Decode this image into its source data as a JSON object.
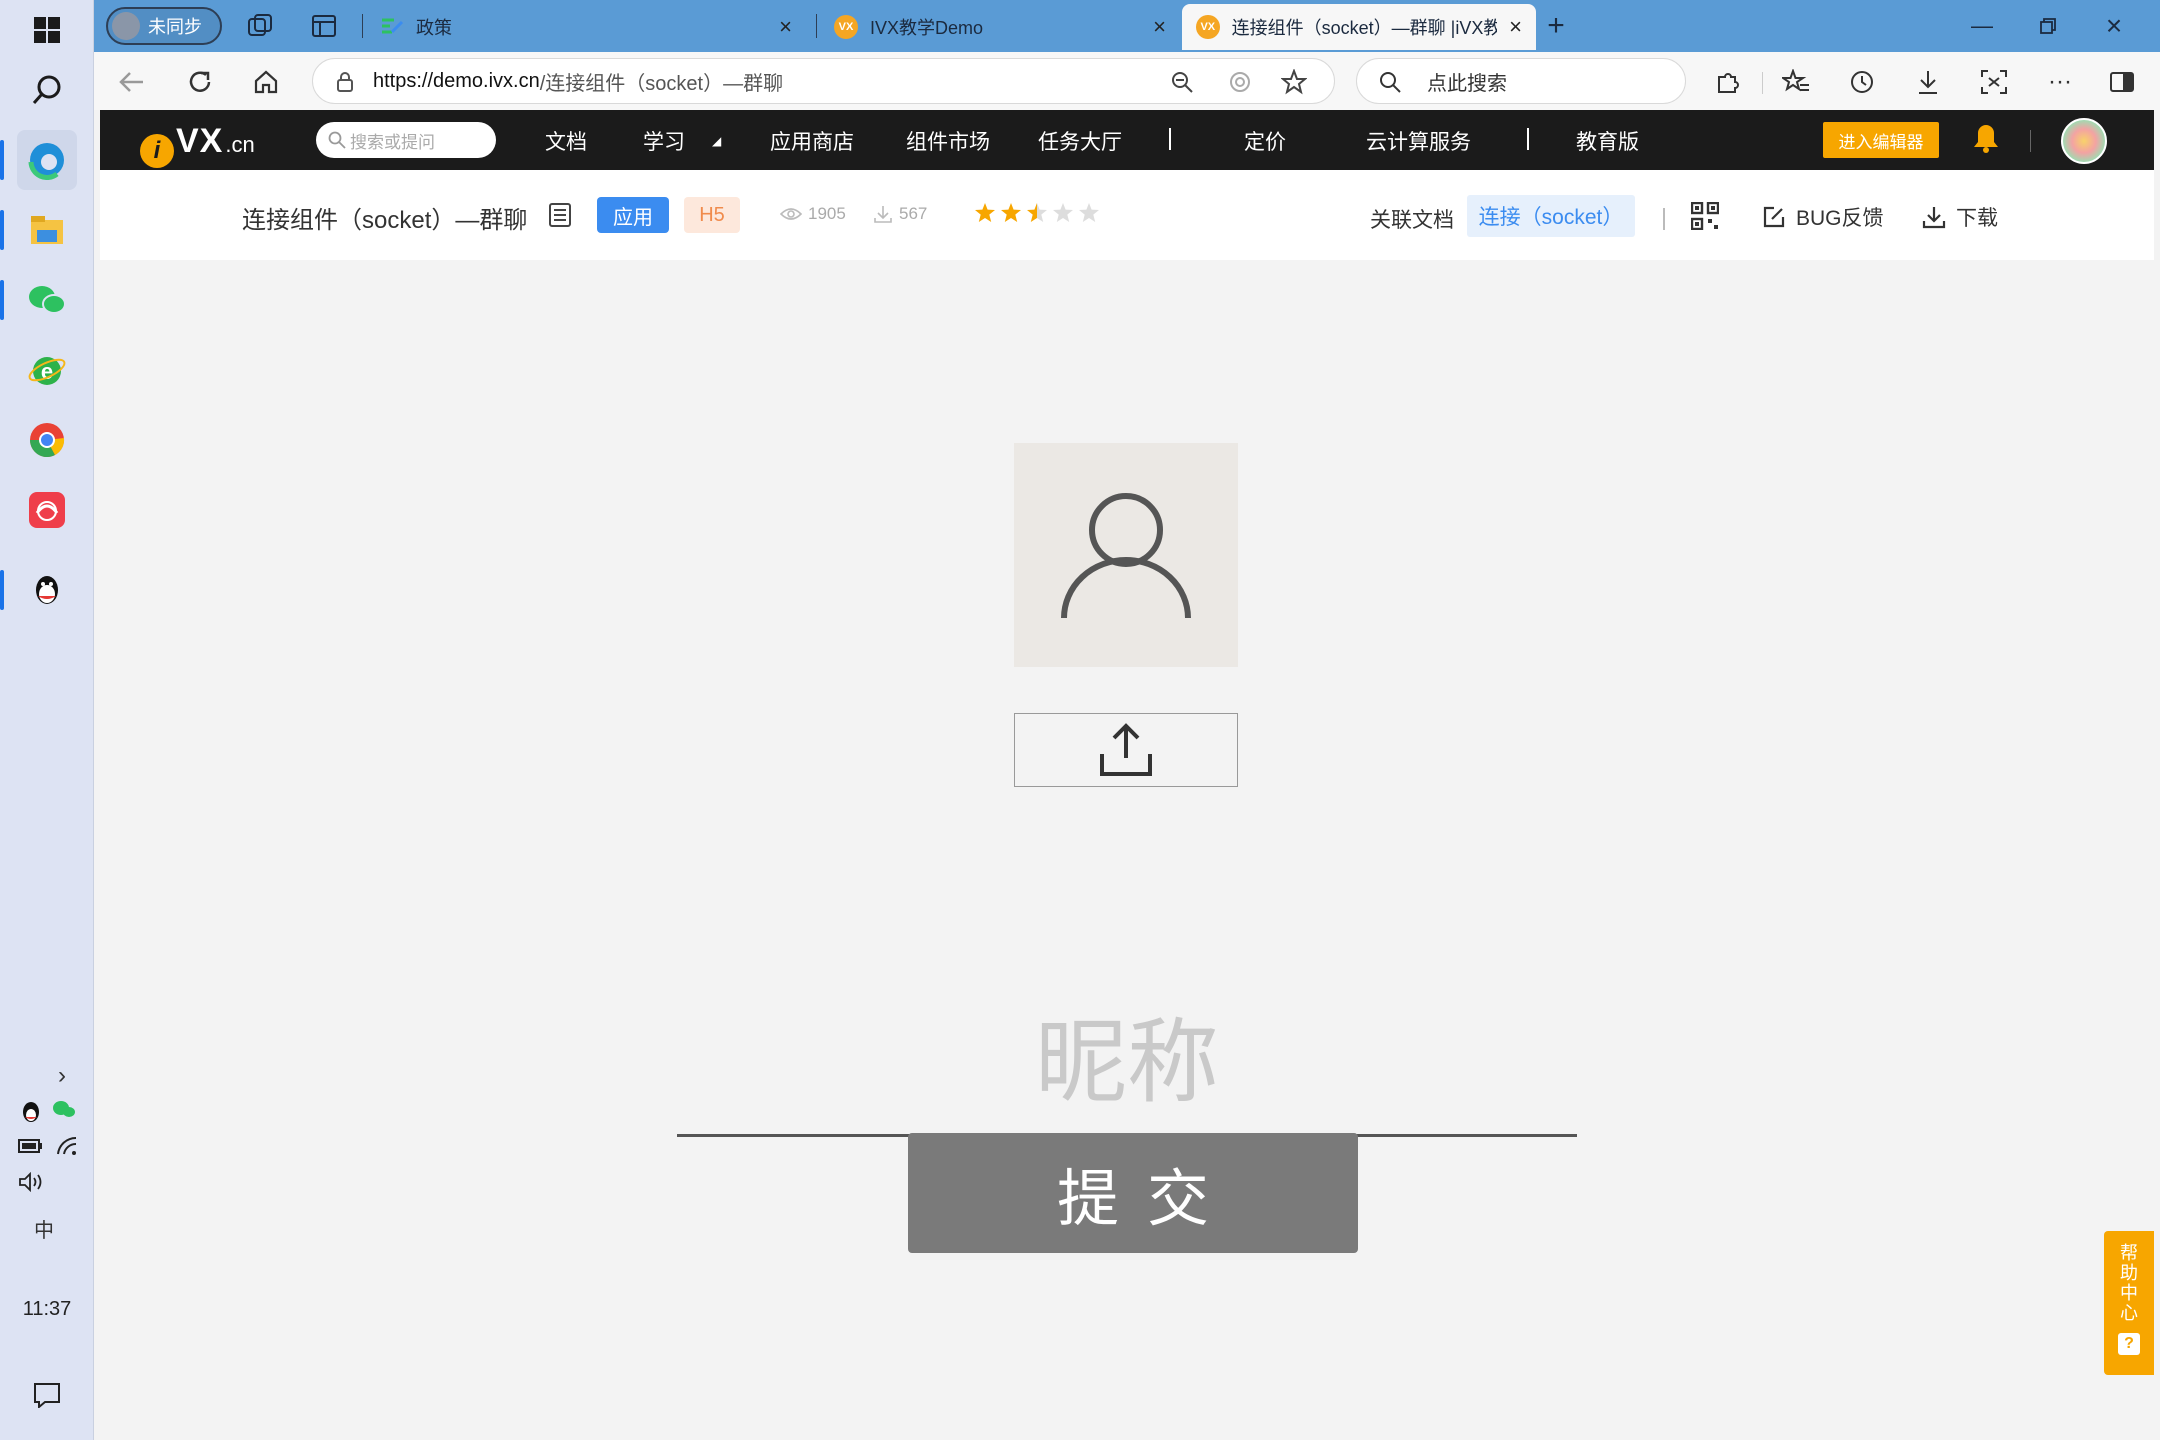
{
  "taskbar": {
    "time": "11:37",
    "ime": "中"
  },
  "browser": {
    "profile_label": "未同步",
    "tabs": [
      {
        "label": "政策"
      },
      {
        "label": "IVX教学Demo",
        "favicon": "VX"
      },
      {
        "label": "连接组件（socket）—群聊 |iVX教",
        "favicon": "VX"
      }
    ],
    "url_host": "https://demo.ivx.cn",
    "url_rest": "/连接组件（socket）—群聊",
    "search_placeholder": "点此搜索"
  },
  "site": {
    "logo_vx": "VX",
    "logo_cn": ".cn",
    "logo_i": "i",
    "search_placeholder": "搜索或提问",
    "nav": {
      "docs": "文档",
      "learn": "学习",
      "app_store": "应用商店",
      "component_market": "组件市场",
      "task_hall": "任务大厅",
      "pricing": "定价",
      "cloud": "云计算服务",
      "edu": "教育版"
    },
    "enter_editor": "进入编辑器"
  },
  "subheader": {
    "title": "连接组件（socket）—群聊",
    "badge_app": "应用",
    "badge_h5": "H5",
    "views": "1905",
    "downloads": "567",
    "rating": 2.5,
    "rating_max": 5,
    "related_docs_label": "关联文档",
    "related_doc_chip": "连接（socket）",
    "bug_feedback": "BUG反馈",
    "download": "下载"
  },
  "app": {
    "nickname_placeholder": "昵称",
    "submit_label": "提交"
  },
  "help": {
    "label_chars": [
      "帮",
      "助",
      "中",
      "心"
    ],
    "q": "?"
  },
  "colors": {
    "tabstrip": "#5a9bd5",
    "nav_bg": "#1b1b1b",
    "accent_orange": "#f7a600",
    "accent_blue": "#3b8cf0",
    "submit_bg": "#7a7a7a"
  }
}
